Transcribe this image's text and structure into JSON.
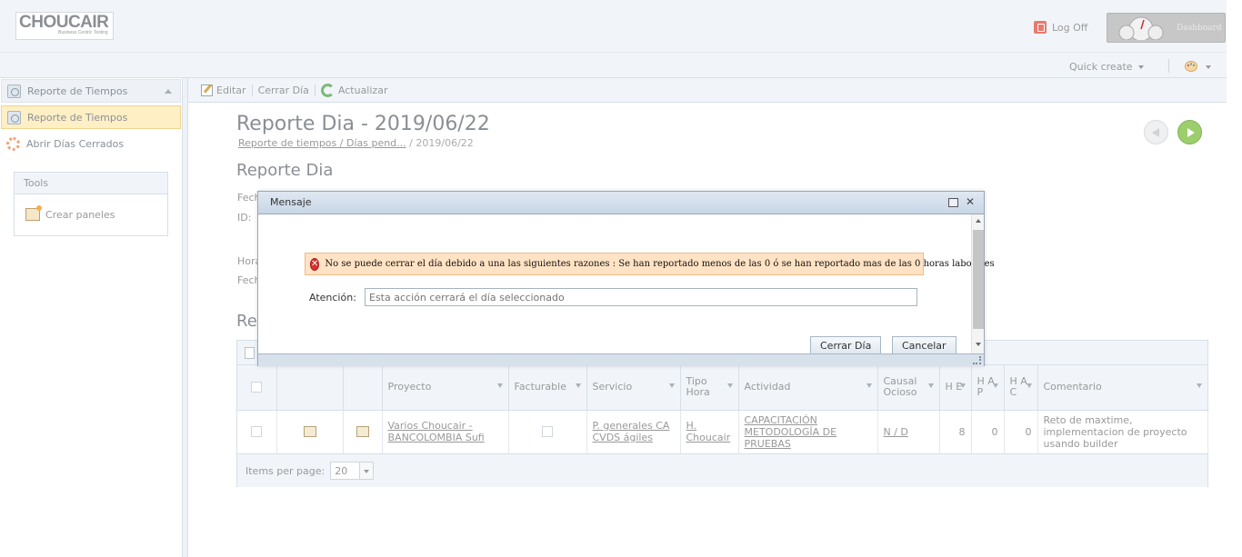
{
  "header": {
    "logo_text": "CHOUCAIR",
    "logo_sub": "Business Centric Testing",
    "logoff_label": "Log Off",
    "dashboard_label": "Dashboard"
  },
  "subheader": {
    "quick_create": "Quick create"
  },
  "sidebar": {
    "section_title": "Reporte de Tiempos",
    "items": [
      {
        "label": "Reporte de Tiempos",
        "active": true
      },
      {
        "label": "Abrir Días Cerrados",
        "active": false
      }
    ],
    "tools": {
      "title": "Tools",
      "item": "Crear paneles"
    }
  },
  "toolbar": {
    "edit": "Editar",
    "close_day": "Cerrar Día",
    "refresh": "Actualizar"
  },
  "main": {
    "title": "Reporte Dia - 2019/06/22",
    "breadcrumb_link": "Reporte de tiempos / Días pend...",
    "breadcrumb_current": " / 2019/06/22",
    "section_title": "Reporte Dia",
    "field_labels": [
      "Fech",
      "ID:",
      "Hora",
      "Fech"
    ],
    "section2_title": "Re"
  },
  "grid": {
    "columns": [
      "",
      "",
      "",
      "Proyecto",
      "Facturable",
      "Servicio",
      "Tipo Hora",
      "Actividad",
      "Causal Ocioso",
      "H E",
      "H A P",
      "H A C",
      "Comentario"
    ],
    "rows": [
      {
        "proyecto": "Varios Choucair - BANCOLOMBIA Sufi",
        "servicio": "P. generales CA CVDS ágiles",
        "tipo_hora": "H. Choucair",
        "actividad": "CAPACITACIÓN METODOLOGÍA DE PRUEBAS",
        "causal": "N / D",
        "he": "8",
        "hap": "0",
        "hac": "0",
        "comentario": "Reto de maxtime, implementacion de proyecto usando builder"
      }
    ],
    "pager_label": "Items per page:",
    "page_size": "20"
  },
  "modal": {
    "title": "Mensaje",
    "error": "No se puede cerrar el día debido a una las siguientes razones : Se han reportado menos de las 0 ó se han reportado mas de las 0 horas laborales",
    "attention_label": "Atención:",
    "attention_placeholder": "Esta acción cerrará el día seleccionado",
    "confirm": "Cerrar Día",
    "cancel": "Cancelar"
  },
  "colors": {
    "error_bg": "#ffe3c4",
    "active_item": "#ffefc5",
    "forward_nav": "#9ccf6b"
  }
}
